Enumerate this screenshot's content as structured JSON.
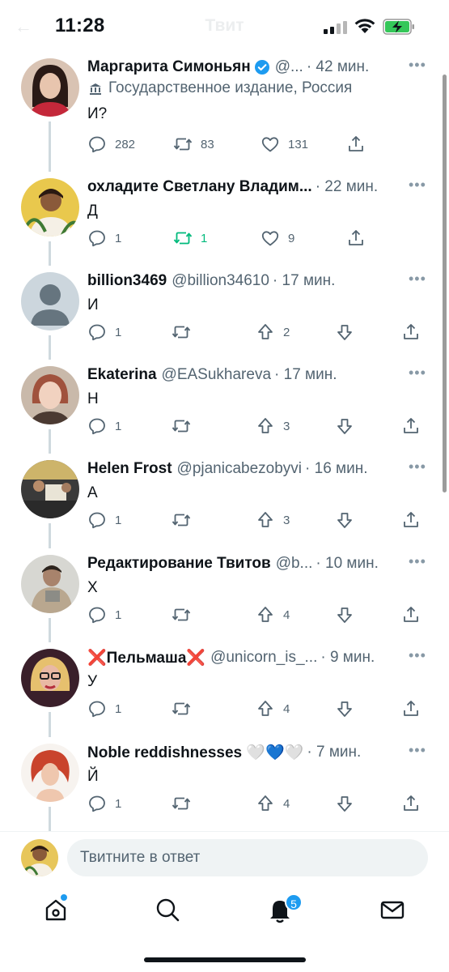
{
  "status_bar": {
    "time": "11:28"
  },
  "header": {
    "title": "Твит",
    "back_icon": "back-arrow-icon"
  },
  "tweets": [
    {
      "name": "Маргарита Симоньян",
      "verified": true,
      "handle": "@...",
      "time": "· 42 мин.",
      "label": "Государственное издание, Россия",
      "text": "И?",
      "actions": {
        "reply": "282",
        "retweet": "83",
        "like": "131"
      },
      "style": "full"
    },
    {
      "name": "охладите Светлану Владим...",
      "handle": "",
      "time": "· 22 мин.",
      "text": "Д",
      "actions": {
        "reply": "1",
        "retweet": "1",
        "like": "9"
      },
      "retweeted": true,
      "style": "full"
    },
    {
      "name": "billion3469",
      "handle": "@billion34610",
      "time": "· 17 мин.",
      "text": "И",
      "actions": {
        "reply": "1",
        "upvote": "2"
      },
      "style": "votes"
    },
    {
      "name": "Ekaterina",
      "handle": "@EASukhareva",
      "time": "· 17 мин.",
      "text": "Н",
      "actions": {
        "reply": "1",
        "upvote": "3"
      },
      "style": "votes"
    },
    {
      "name": "Helen Frost",
      "handle": "@pjanicabezobyvi",
      "time": "· 16 мин.",
      "text": "А",
      "actions": {
        "reply": "1",
        "upvote": "3"
      },
      "style": "votes"
    },
    {
      "name": "Редактирование Твитов",
      "handle": "@b...",
      "time": "· 10 мин.",
      "text": "Х",
      "actions": {
        "reply": "1",
        "upvote": "4"
      },
      "style": "votes"
    },
    {
      "name": "❌Пельмаша❌",
      "handle": "@unicorn_is_...",
      "time": "· 9 мин.",
      "text": "У",
      "actions": {
        "reply": "1",
        "upvote": "4"
      },
      "style": "votes"
    },
    {
      "name": "Noble reddishnesses 🤍💙🤍",
      "handle": "",
      "time": "· 7 мин.",
      "text": "Й",
      "actions": {
        "reply": "1",
        "upvote": "4"
      },
      "style": "votes"
    }
  ],
  "reply_bar": {
    "placeholder": "Твитните в ответ"
  },
  "tabbar": {
    "notifications_badge": "5"
  },
  "colors": {
    "accent": "#1d9bf0",
    "retweet_green": "#00ba7c",
    "muted": "#536471"
  }
}
